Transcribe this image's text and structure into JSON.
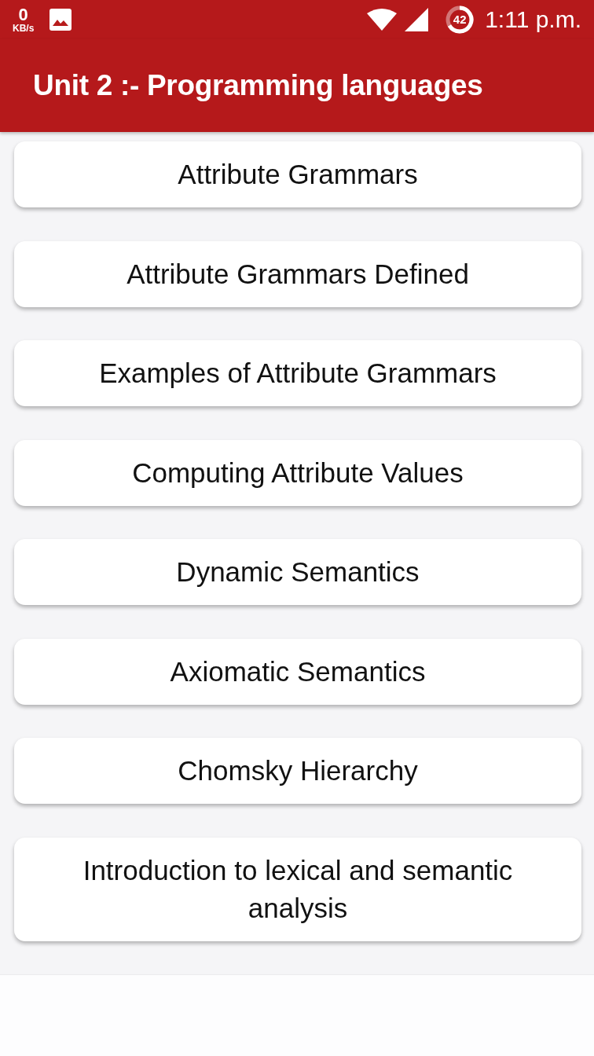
{
  "status_bar": {
    "network_speed": {
      "value": "0",
      "unit": "KB/s"
    },
    "battery": {
      "text": "42"
    },
    "time": "1:11 p.m."
  },
  "app_bar": {
    "title": "Unit 2 :- Programming languages"
  },
  "topics": [
    {
      "label": "Attribute Grammars"
    },
    {
      "label": "Attribute Grammars Defined"
    },
    {
      "label": "Examples of Attribute Grammars"
    },
    {
      "label": "Computing Attribute Values"
    },
    {
      "label": "Dynamic Semantics"
    },
    {
      "label": "Axiomatic Semantics"
    },
    {
      "label": "Chomsky Hierarchy"
    },
    {
      "label": "Introduction to lexical and semantic analysis"
    }
  ]
}
